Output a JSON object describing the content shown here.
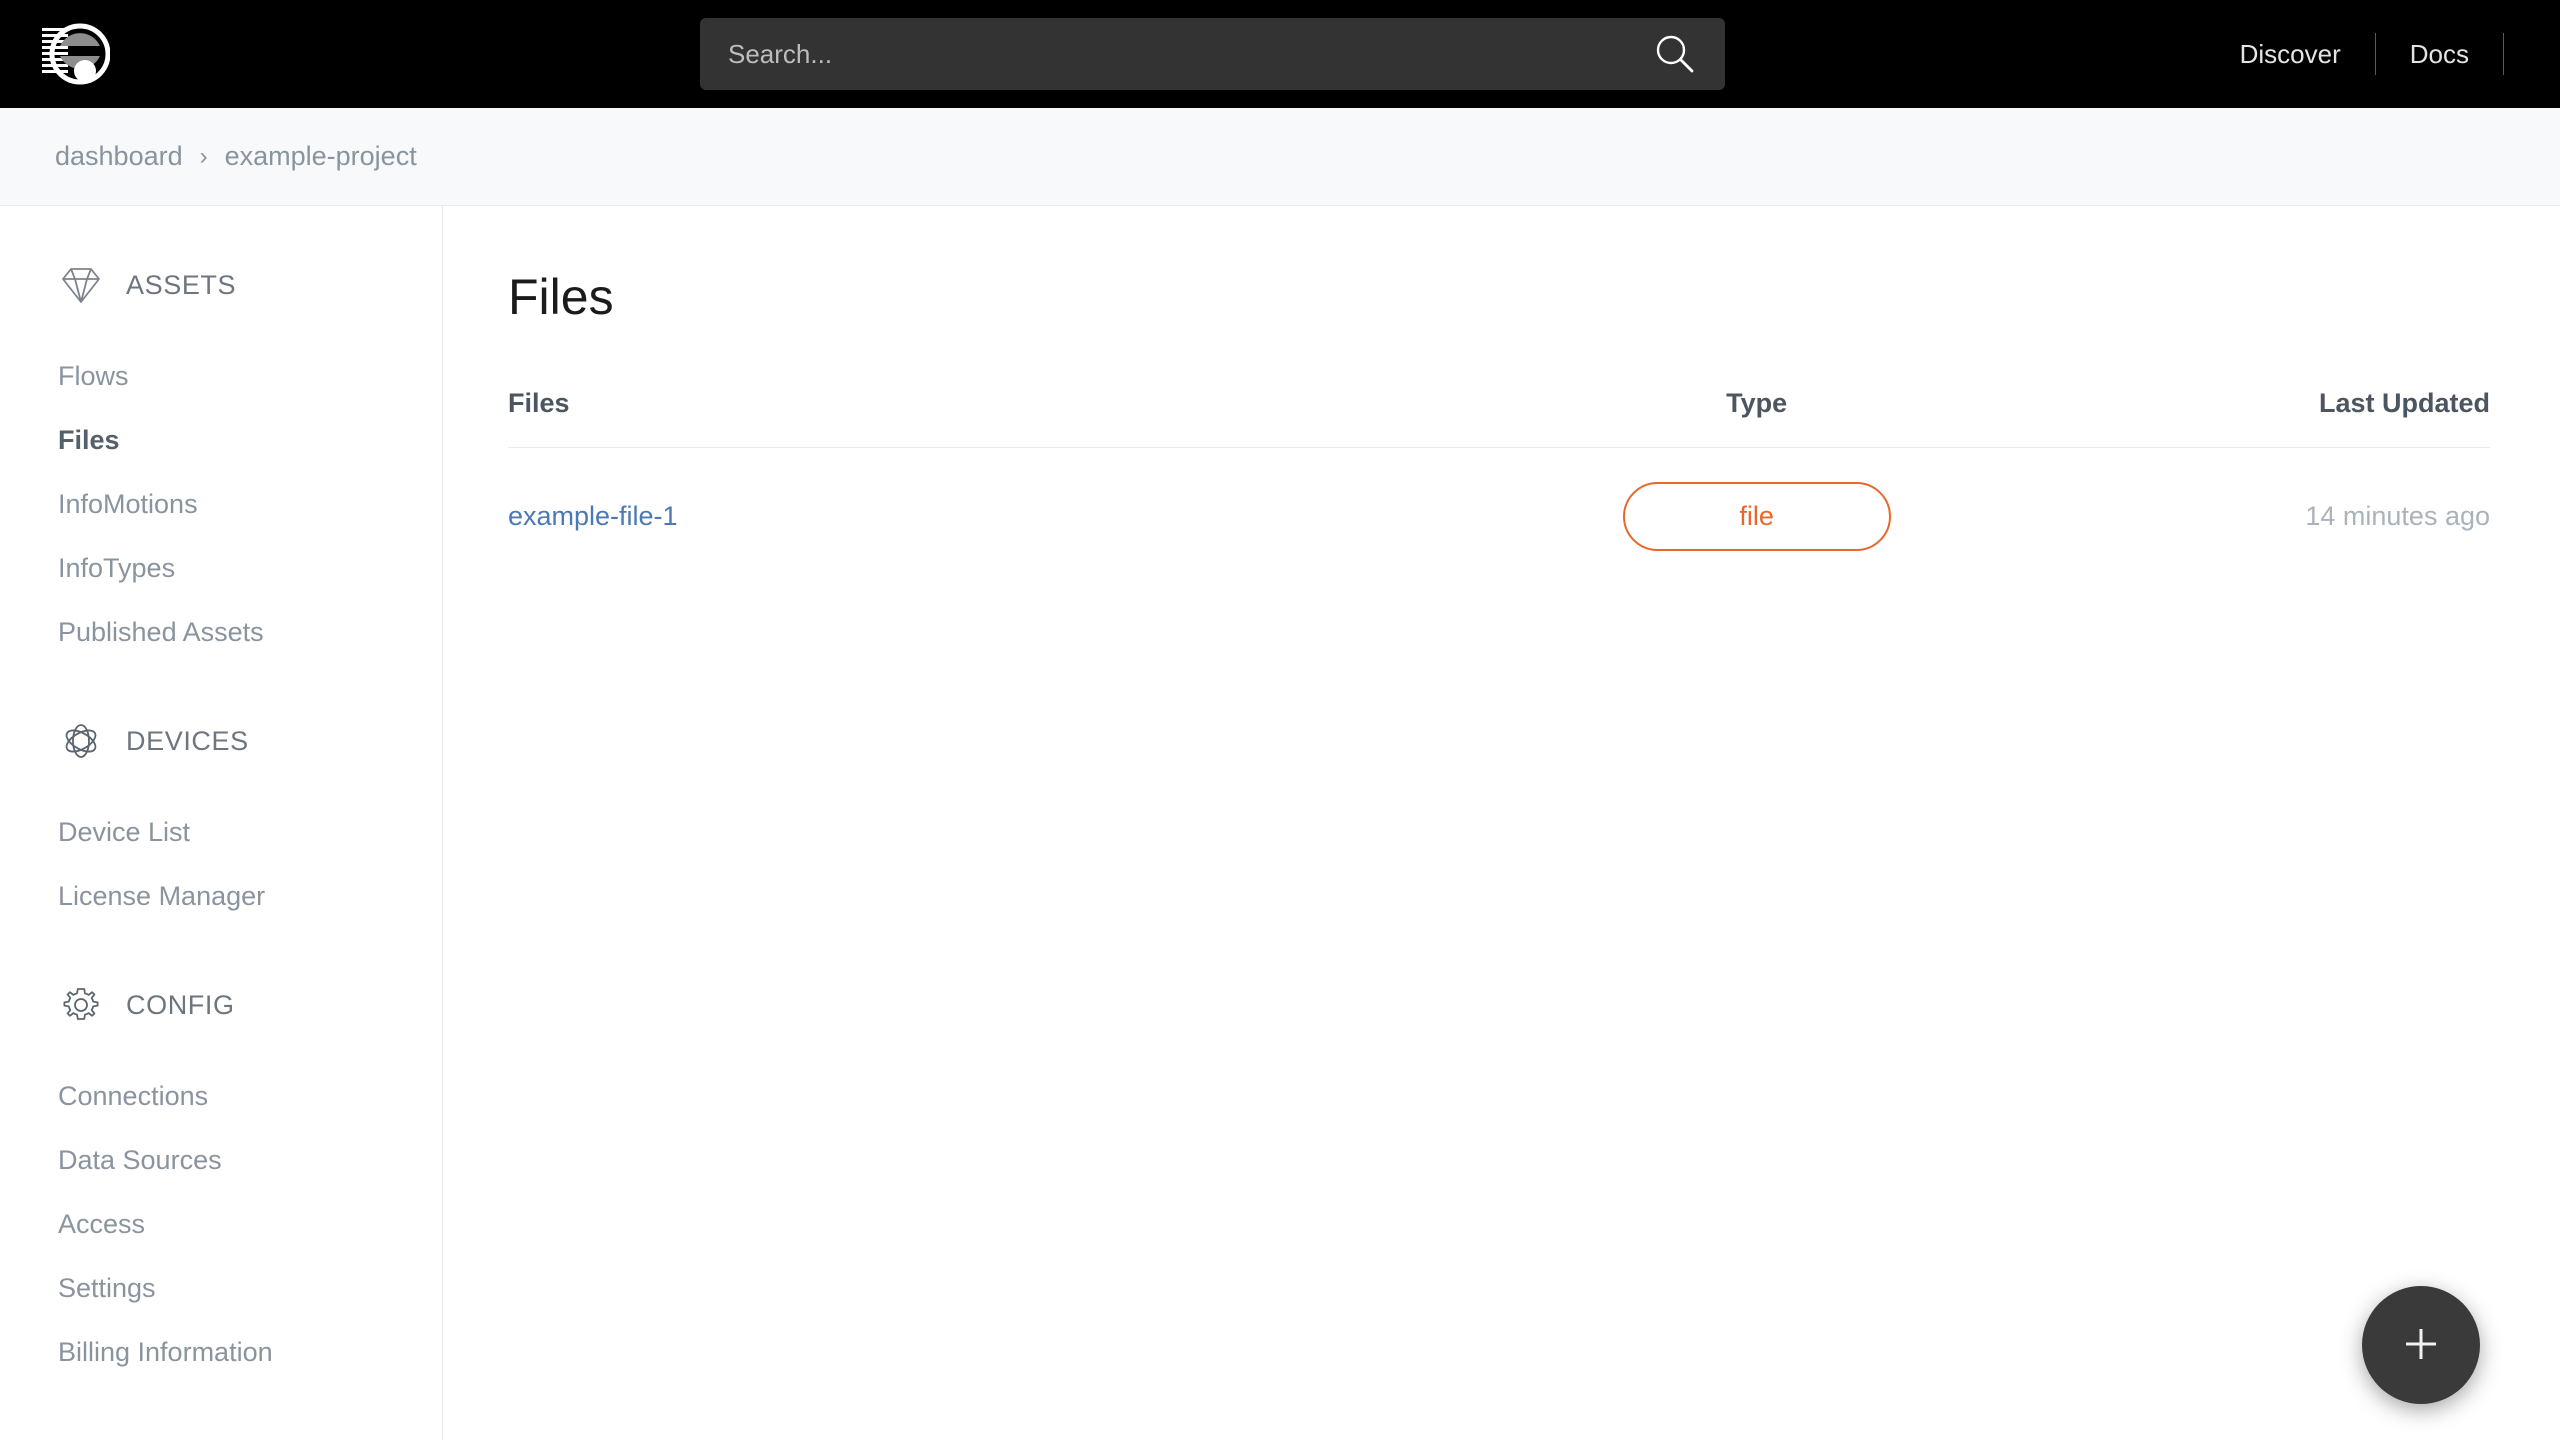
{
  "header": {
    "logo_name": "company-logo",
    "search": {
      "placeholder": "Search...",
      "value": "",
      "icon": "search-icon"
    },
    "nav": [
      {
        "label": "Discover"
      },
      {
        "label": "Docs"
      }
    ]
  },
  "breadcrumb": {
    "separator": "›",
    "items": [
      {
        "label": "dashboard"
      },
      {
        "label": "example-project"
      }
    ]
  },
  "sidebar": {
    "groups": [
      {
        "label": "ASSETS",
        "icon": "diamond-icon",
        "items": [
          {
            "label": "Flows",
            "active": false
          },
          {
            "label": "Files",
            "active": true
          },
          {
            "label": "InfoMotions",
            "active": false
          },
          {
            "label": "InfoTypes",
            "active": false
          },
          {
            "label": "Published Assets",
            "active": false
          }
        ]
      },
      {
        "label": "DEVICES",
        "icon": "atom-icon",
        "items": [
          {
            "label": "Device List",
            "active": false
          },
          {
            "label": "License Manager",
            "active": false
          }
        ]
      },
      {
        "label": "CONFIG",
        "icon": "gear-icon",
        "items": [
          {
            "label": "Connections",
            "active": false
          },
          {
            "label": "Data Sources",
            "active": false
          },
          {
            "label": "Access",
            "active": false
          },
          {
            "label": "Settings",
            "active": false
          },
          {
            "label": "Billing Information",
            "active": false
          }
        ]
      }
    ]
  },
  "main": {
    "title": "Files",
    "table": {
      "headers": {
        "files": "Files",
        "type": "Type",
        "updated": "Last Updated"
      },
      "rows": [
        {
          "file": "example-file-1",
          "type": "file",
          "updated": "14 minutes ago"
        }
      ]
    }
  },
  "fab": {
    "icon": "plus-icon",
    "label": "+"
  },
  "colors": {
    "topbar_bg": "#000000",
    "search_bg": "#333333",
    "breadcrumb_bg": "#f8f9fb",
    "accent_orange": "#e8682c",
    "link_blue": "#4a79b5",
    "muted_text": "#8a949e",
    "fab_bg": "#3a3a3a"
  }
}
